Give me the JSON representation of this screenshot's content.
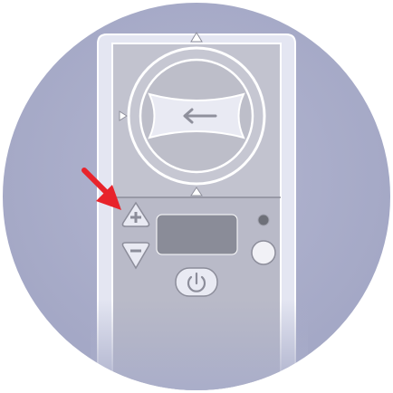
{
  "illustration": {
    "subject": "device-control-panel",
    "highlighted_control": "plus-button"
  },
  "icons": {
    "plus": "plus-icon",
    "minus": "minus-icon",
    "power": "power-icon",
    "arrow": "arrow-left-icon",
    "pointer": "red-arrow-pointer"
  },
  "colors": {
    "background_circle": "#a9adc9",
    "device_body": "#e4e6f2",
    "device_outline": "#ffffff",
    "panel_face": "#b8b9c7",
    "display": "#888a96",
    "pointer": "#e8232b"
  }
}
